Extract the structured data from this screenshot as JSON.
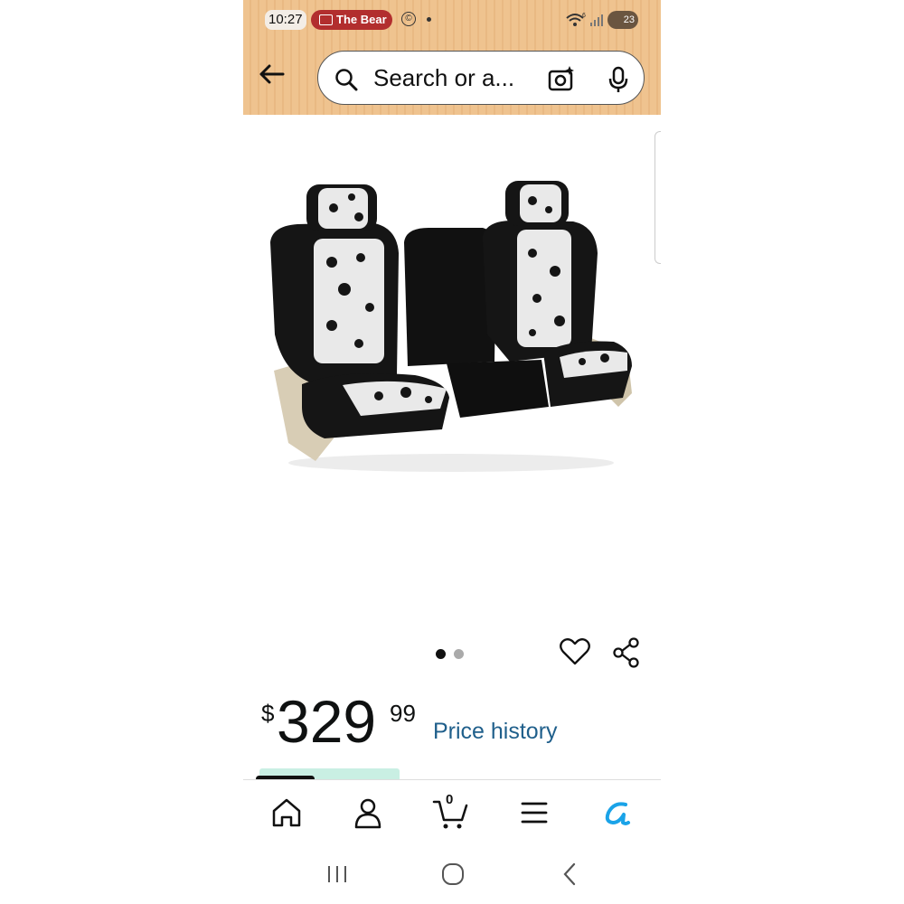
{
  "status_bar": {
    "time": "10:27",
    "cast_label": "The Bear",
    "circle_indicator": "©",
    "wifi_badge": "6",
    "battery_level": "23"
  },
  "search": {
    "placeholder": "Search or a...",
    "back_icon": "arrow-left-icon",
    "search_icon": "magnifier-icon",
    "camera_icon": "camera-sparkle-icon",
    "mic_icon": "microphone-icon"
  },
  "product": {
    "image_alt": "seat-covers-image",
    "carousel": {
      "count": 2,
      "active_index": 0
    }
  },
  "price": {
    "currency": "$",
    "whole": "329",
    "fraction": "99",
    "history_link": "Price history"
  },
  "bottom_nav": {
    "items": [
      "home",
      "account",
      "cart",
      "menu",
      "rufus"
    ],
    "cart_count": "0"
  },
  "colors": {
    "header_bg": "#efc38f",
    "cast_pill": "#b22e2e",
    "link": "#1f5f8b",
    "rufus_blue": "#1aa3e8",
    "active_dot": "#111111",
    "inactive_dot": "#aaaaaa"
  }
}
